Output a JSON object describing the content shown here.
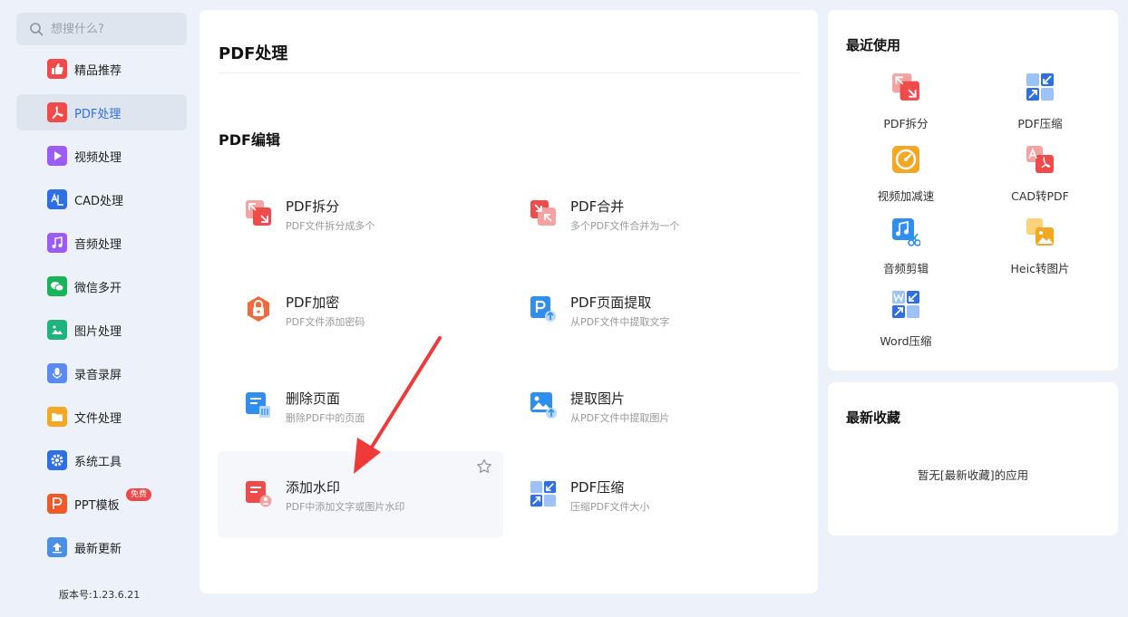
{
  "sidebar": {
    "search_placeholder": "想搜什么?",
    "items": [
      {
        "label": "精品推荐",
        "icon": "thumbs-up-icon",
        "color": "#ef4b4b"
      },
      {
        "label": "PDF处理",
        "icon": "pdf-icon",
        "color": "#ef4b4b",
        "active": true
      },
      {
        "label": "视频处理",
        "icon": "play-icon",
        "color": "#9b5cf6"
      },
      {
        "label": "CAD处理",
        "icon": "cad-icon",
        "color": "#2f6fe4"
      },
      {
        "label": "音频处理",
        "icon": "music-icon",
        "color": "#9b5cf6"
      },
      {
        "label": "微信多开",
        "icon": "wechat-icon",
        "color": "#19b35a"
      },
      {
        "label": "图片处理",
        "icon": "image-icon",
        "color": "#1fb37d"
      },
      {
        "label": "录音录屏",
        "icon": "microphone-icon",
        "color": "#5b8af5"
      },
      {
        "label": "文件处理",
        "icon": "folder-icon",
        "color": "#f5a623"
      },
      {
        "label": "系统工具",
        "icon": "gear-icon",
        "color": "#2f6fe4"
      },
      {
        "label": "PPT模板",
        "icon": "ppt-icon",
        "color": "#f05a28",
        "badge": "免费"
      },
      {
        "label": "最新更新",
        "icon": "upload-icon",
        "color": "#4a90e2"
      }
    ],
    "version": "版本号:1.23.6.21"
  },
  "main": {
    "title": "PDF处理",
    "section_title": "PDF编辑",
    "tools": [
      {
        "name": "PDF拆分",
        "desc": "PDF文件拆分成多个",
        "icon": "pdf-split-icon"
      },
      {
        "name": "PDF合并",
        "desc": "多个PDF文件合并为一个",
        "icon": "pdf-merge-icon"
      },
      {
        "name": "PDF加密",
        "desc": "PDF文件添加密码",
        "icon": "pdf-lock-icon"
      },
      {
        "name": "PDF页面提取",
        "desc": "从PDF文件中提取文字",
        "icon": "pdf-page-extract-icon"
      },
      {
        "name": "删除页面",
        "desc": "删除PDF中的页面",
        "icon": "delete-page-icon"
      },
      {
        "name": "提取图片",
        "desc": "从PDF文件中提取图片",
        "icon": "extract-image-icon"
      },
      {
        "name": "添加水印",
        "desc": "PDF中添加文字或图片水印",
        "icon": "watermark-icon",
        "hovered": true
      },
      {
        "name": "PDF压缩",
        "desc": "压缩PDF文件大小",
        "icon": "pdf-compress-icon"
      }
    ]
  },
  "recent": {
    "title": "最近使用",
    "items": [
      {
        "label": "PDF拆分",
        "icon": "pdf-split-icon"
      },
      {
        "label": "PDF压缩",
        "icon": "pdf-compress-icon"
      },
      {
        "label": "视频加减速",
        "icon": "video-speed-icon"
      },
      {
        "label": "CAD转PDF",
        "icon": "cad-to-pdf-icon"
      },
      {
        "label": "音频剪辑",
        "icon": "audio-cut-icon"
      },
      {
        "label": "Heic转图片",
        "icon": "heic-to-image-icon"
      },
      {
        "label": "Word压缩",
        "icon": "word-compress-icon"
      }
    ]
  },
  "favorites": {
    "title": "最新收藏",
    "empty_text": "暂无[最新收藏]的应用"
  },
  "colors": {
    "accent": "#2f6fe4",
    "arrow": "#f03a3a",
    "background": "#edf2fa"
  }
}
